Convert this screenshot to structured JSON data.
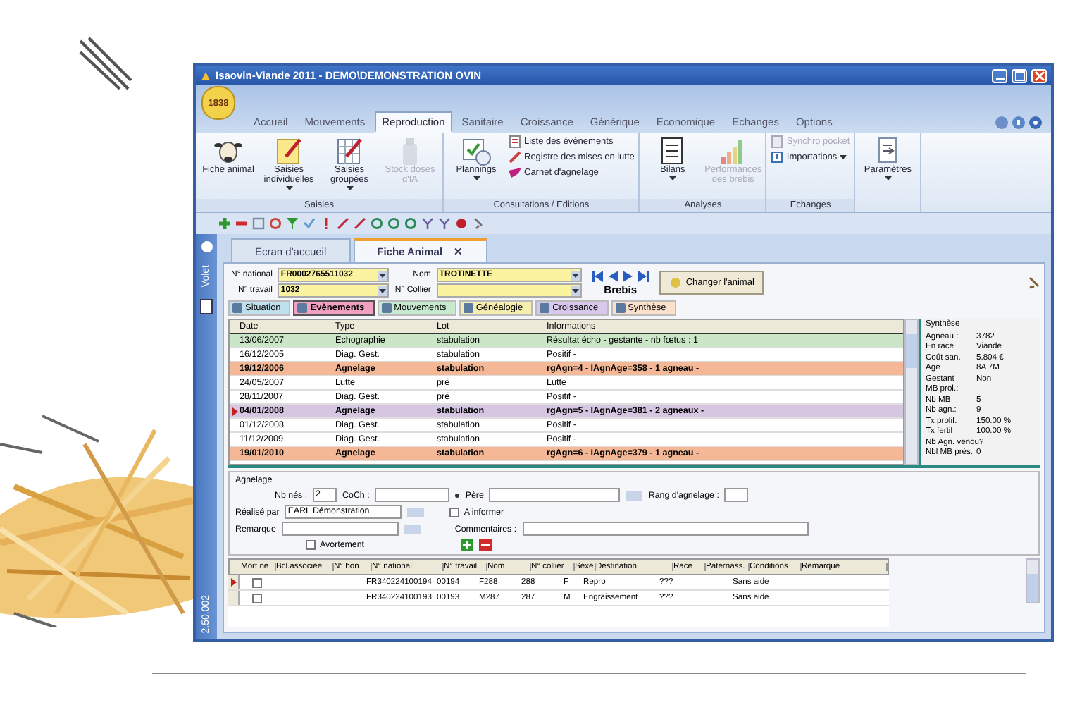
{
  "window": {
    "title": "Isaovin-Viande 2011 - DEMO\\DEMONSTRATION OVIN"
  },
  "logo": {
    "text": "1838"
  },
  "ribbon_tabs": [
    {
      "label": "Accueil",
      "selected": false
    },
    {
      "label": "Mouvements",
      "selected": false
    },
    {
      "label": "Reproduction",
      "selected": true
    },
    {
      "label": "Sanitaire",
      "selected": false
    },
    {
      "label": "Croissance",
      "selected": false
    },
    {
      "label": "Générique",
      "selected": false
    },
    {
      "label": "Economique",
      "selected": false
    },
    {
      "label": "Echanges",
      "selected": false
    },
    {
      "label": "Options",
      "selected": false
    }
  ],
  "ribbon_groups": [
    {
      "label": "Saisies",
      "items": [
        {
          "kind": "large",
          "label": "Fiche animal",
          "dropdown": false,
          "disabled": false
        },
        {
          "kind": "large",
          "label": "Saisies individuelles",
          "dropdown": true,
          "disabled": false
        },
        {
          "kind": "large",
          "label": "Saisies groupées",
          "dropdown": true,
          "disabled": false
        },
        {
          "kind": "large",
          "label": "Stock doses d'IA",
          "dropdown": false,
          "disabled": true
        }
      ]
    },
    {
      "label": "Consultations / Editions",
      "items": [
        {
          "kind": "large",
          "label": "Plannings",
          "dropdown": true,
          "disabled": false
        },
        {
          "kind": "small",
          "label": "Liste des évènements",
          "dropdown": false,
          "disabled": false
        },
        {
          "kind": "small",
          "label": "Registre des mises en lutte",
          "dropdown": false,
          "disabled": false
        },
        {
          "kind": "small",
          "label": "Carnet d'agnelage",
          "dropdown": false,
          "disabled": false
        }
      ]
    },
    {
      "label": "Analyses",
      "items": [
        {
          "kind": "large",
          "label": "Bilans",
          "dropdown": true,
          "disabled": false
        },
        {
          "kind": "large",
          "label": "Performances des brebis",
          "dropdown": false,
          "disabled": true
        }
      ]
    },
    {
      "label": "Echanges",
      "items": [
        {
          "kind": "small",
          "label": "Synchro pocket",
          "dropdown": false,
          "disabled": true
        },
        {
          "kind": "small",
          "label": "Importations",
          "dropdown": true,
          "disabled": false
        }
      ]
    },
    {
      "items": [
        {
          "kind": "large",
          "label": "Paramètres",
          "dropdown": true,
          "disabled": false
        }
      ]
    }
  ],
  "side_panel": {
    "label": "Volet",
    "version": "2.50.002"
  },
  "doc_tabs": [
    {
      "label": "Ecran d'accueil",
      "selected": false
    },
    {
      "label": "Fiche Animal",
      "selected": true,
      "close": "✕"
    }
  ],
  "animal_form": {
    "national_label": "N° national",
    "national": "FR0002765511032",
    "work_label": "N° travail",
    "work": "1032",
    "name_label": "Nom",
    "name": "TROTINETTE",
    "collar_label": "N° Collier",
    "sex": "Brebis",
    "change_button": "Changer l'animal"
  },
  "sub_tabs": [
    {
      "label": "Situation",
      "color": "#bfe0ec",
      "selected": false
    },
    {
      "label": "Evènements",
      "color": "#f2a0c0",
      "selected": true
    },
    {
      "label": "Mouvements",
      "color": "#c8ead0",
      "selected": false
    },
    {
      "label": "Généalogie",
      "color": "#f6eeb0",
      "selected": false
    },
    {
      "label": "Croissance",
      "color": "#d8c8ec",
      "selected": false
    },
    {
      "label": "Synthèse",
      "color": "#fbe0cc",
      "selected": false
    }
  ],
  "events": {
    "columns": [
      "Date",
      "Type",
      "Lot",
      "Informations"
    ],
    "rows": [
      {
        "cells": [
          "13/06/2007",
          "Echographie",
          "stabulation",
          "Résultat écho - gestante - nb fœtus : 1"
        ],
        "color": "#cbe6c6",
        "bold": false,
        "current": false
      },
      {
        "cells": [
          "16/12/2005",
          "Diag. Gest.",
          "stabulation",
          "Positif -"
        ],
        "color": "#ffffff",
        "bold": false,
        "current": false
      },
      {
        "cells": [
          "19/12/2006",
          "Agnelage",
          "stabulation",
          "rgAgn=4 - IAgnAge=358 - 1 agneau -"
        ],
        "color": "#f5b896",
        "bold": true,
        "current": false
      },
      {
        "cells": [
          "24/05/2007",
          "Lutte",
          "pré",
          "Lutte"
        ],
        "color": "#ffffff",
        "bold": false,
        "current": false
      },
      {
        "cells": [
          "28/11/2007",
          "Diag. Gest.",
          "pré",
          "Positif -"
        ],
        "color": "#ffffff",
        "bold": false,
        "current": false
      },
      {
        "cells": [
          "04/01/2008",
          "Agnelage",
          "stabulation",
          "rgAgn=5 - IAgnAge=381 - 2 agneaux -"
        ],
        "color": "#d6c6e2",
        "bold": true,
        "current": true
      },
      {
        "cells": [
          "01/12/2008",
          "Diag. Gest.",
          "stabulation",
          "Positif -"
        ],
        "color": "#ffffff",
        "bold": false,
        "current": false
      },
      {
        "cells": [
          "11/12/2009",
          "Diag. Gest.",
          "stabulation",
          "Positif -"
        ],
        "color": "#ffffff",
        "bold": false,
        "current": false
      },
      {
        "cells": [
          "19/01/2010",
          "Agnelage",
          "stabulation",
          "rgAgn=6 - IAgnAge=379 - 1 agneau -"
        ],
        "color": "#f5b896",
        "bold": true,
        "current": false
      }
    ]
  },
  "synthesis": {
    "title": "Synthèse",
    "rows": [
      {
        "label": "Agneau :",
        "value": "3782"
      },
      {
        "label": "En race",
        "value": "Viande"
      },
      {
        "label": "Coût san.",
        "value": "5.804 €"
      },
      {
        "label": "Age",
        "value": "8A 7M"
      },
      {
        "label": "Gestant",
        "value": "Non"
      },
      {
        "label": "MB prol.:"
      },
      {
        "label": "Nb MB",
        "value": "5"
      },
      {
        "label": "Nb agn.:",
        "value": "9"
      },
      {
        "label": "Tx prolif.",
        "value": "150.00 %"
      },
      {
        "label": "Tx fertil",
        "value": "100.00 %"
      },
      {
        "label": "Nb Agn. vendu?"
      },
      {
        "label": "Nbl MB prés.",
        "value": "0"
      }
    ]
  },
  "lambing": {
    "title": "Agnelage",
    "born_label": "Nb nés :",
    "born": "2",
    "coch_label": "CoCh :",
    "father_label": "Père",
    "rank_label": "Rang d'agnelage :",
    "by_label": "Réalisé par",
    "by": "EARL Démonstration",
    "inform_label": "A informer",
    "inform": false,
    "remark_label": "Remarque",
    "comments_label": "Commentaires :",
    "abortion_label": "Avortement",
    "abortion": false
  },
  "lambs": {
    "columns": [
      "Mort né",
      "Bcl.associée",
      "N° bon",
      "N° national",
      "N° travail",
      "Nom",
      "N° collier",
      "Sexe",
      "Destination",
      "Race",
      "Paternass.",
      "Conditions",
      "Remarque"
    ],
    "rows": [
      {
        "current": true,
        "dead": false,
        "cells": [
          "",
          "",
          "",
          "FR340224100194",
          "00194",
          "F288",
          "288",
          "F",
          "Repro",
          "???",
          "",
          "Sans aide",
          ""
        ]
      },
      {
        "current": false,
        "dead": false,
        "cells": [
          "",
          "",
          "",
          "FR340224100193",
          "00193",
          "M287",
          "287",
          "M",
          "Engraissement",
          "???",
          "",
          "Sans aide",
          ""
        ]
      }
    ]
  }
}
